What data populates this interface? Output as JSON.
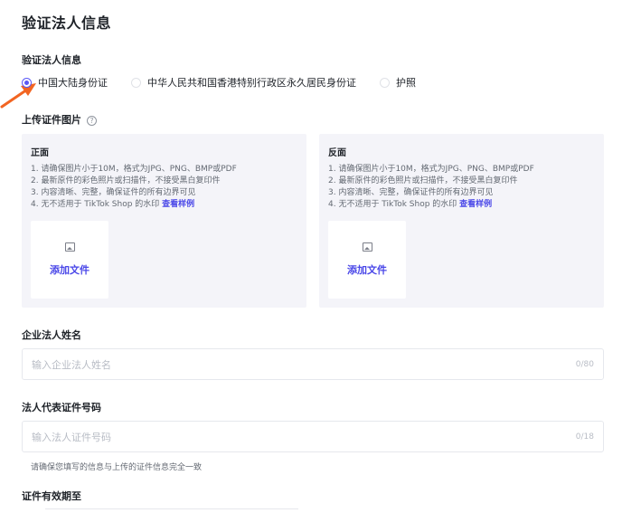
{
  "page": {
    "title": "验证法人信息"
  },
  "section": {
    "title": "验证法人信息"
  },
  "id_type": {
    "options": [
      {
        "label": "中国大陆身份证",
        "selected": true
      },
      {
        "label": "中华人民共和国香港特别行政区永久居民身份证",
        "selected": false
      },
      {
        "label": "护照",
        "selected": false
      }
    ]
  },
  "upload": {
    "title": "上传证件图片",
    "help_icon": "question-circle-icon",
    "cards": [
      {
        "title": "正面",
        "notes": [
          "1. 请确保图片小于10M，格式为JPG、PNG、BMP或PDF",
          "2. 最新原件的彩色照片或扫描件，不接受黑白复印件",
          "3. 内容清晰、完整，确保证件的所有边界可见",
          "4. 无不适用于 TikTok Shop 的水印"
        ],
        "sample_link": "查看样例",
        "button": "添加文件"
      },
      {
        "title": "反面",
        "notes": [
          "1. 请确保图片小于10M，格式为JPG、PNG、BMP或PDF",
          "2. 最新原件的彩色照片或扫描件，不接受黑白复印件",
          "3. 内容清晰、完整，确保证件的所有边界可见",
          "4. 无不适用于 TikTok Shop 的水印"
        ],
        "sample_link": "查看样例",
        "button": "添加文件"
      }
    ]
  },
  "legal_name": {
    "label": "企业法人姓名",
    "placeholder": "输入企业法人姓名",
    "count": "0/80"
  },
  "legal_id": {
    "label": "法人代表证件号码",
    "placeholder": "输入法人证件号码",
    "count": "0/18",
    "hint": "请确保您填写的信息与上传的证件信息完全一致"
  },
  "expiry": {
    "label": "证件有效期至"
  },
  "colors": {
    "accent": "#5b59f7",
    "link": "#4a47e8",
    "card_bg": "#f4f4f9",
    "arrow": "#f26522"
  }
}
